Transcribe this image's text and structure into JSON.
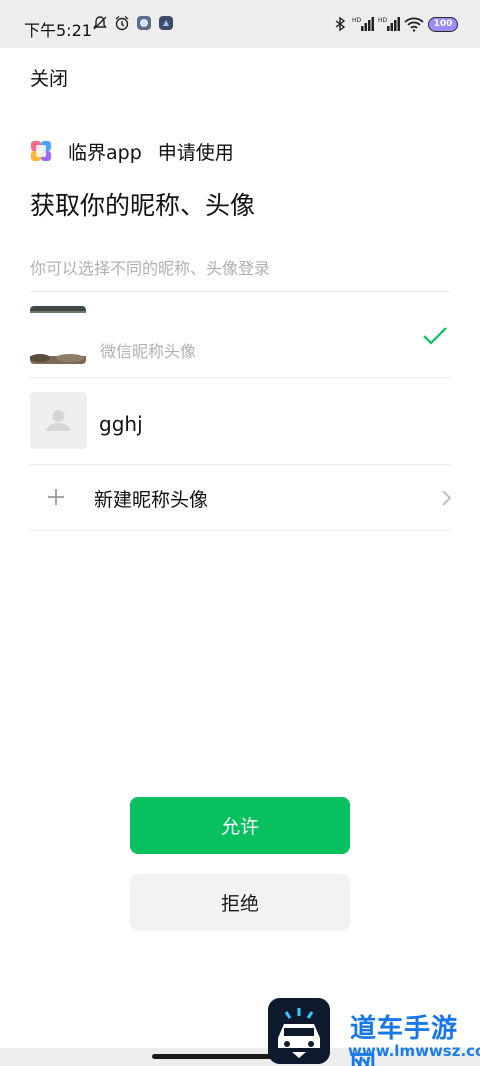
{
  "status_bar": {
    "time": "下午5:21",
    "battery": "100",
    "icons_left": [
      "mute-bell-icon",
      "alarm-icon",
      "app-notification-icon",
      "app-notification-icon-2"
    ],
    "icons_right": [
      "bluetooth-icon",
      "hd-signal-icon",
      "hd-signal-icon-2",
      "wifi-icon",
      "battery-icon"
    ]
  },
  "header": {
    "close_label": "关闭"
  },
  "app": {
    "name": "临界app",
    "request": "申请使用"
  },
  "title": "获取你的昵称、头像",
  "subtitle": "你可以选择不同的昵称、头像登录",
  "profiles": [
    {
      "label": "微信昵称头像",
      "selected": true
    },
    {
      "label": "gghj",
      "selected": false
    }
  ],
  "new_profile_label": "新建昵称头像",
  "buttons": {
    "allow": "允许",
    "deny": "拒绝"
  },
  "colors": {
    "accent": "#07c160",
    "check": "#07c160"
  },
  "watermark": {
    "title": "道车手游网",
    "url": "www.lmwwsz.com"
  }
}
